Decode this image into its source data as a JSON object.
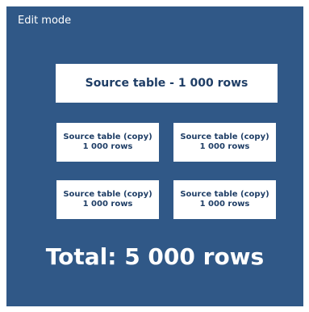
{
  "header": {
    "mode_label": "Edit mode"
  },
  "source": {
    "label": "Source table - 1 000 rows"
  },
  "copies": [
    {
      "title": "Source table (copy)",
      "rows": "1 000 rows"
    },
    {
      "title": "Source table (copy)",
      "rows": "1 000 rows"
    },
    {
      "title": "Source table (copy)",
      "rows": "1 000 rows"
    },
    {
      "title": "Source table (copy)",
      "rows": "1 000 rows"
    }
  ],
  "total": {
    "label": "Total: 5 000 rows"
  },
  "colors": {
    "background": "#305887",
    "box": "#ffffff",
    "box_text": "#1f3e66",
    "header_text": "#ffffff"
  }
}
